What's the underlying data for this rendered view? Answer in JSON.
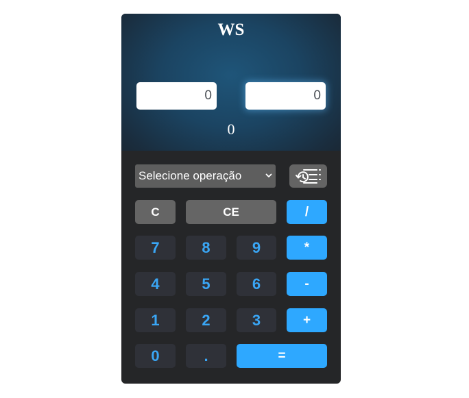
{
  "calculator": {
    "title": "WS",
    "input_one": {
      "value": "",
      "placeholder": "0"
    },
    "input_two": {
      "value": "",
      "placeholder": "0"
    },
    "result": "0",
    "operation_select": {
      "selected": "Selecione operação"
    },
    "history_button_icon": "history-list-icon",
    "keys": {
      "clear": "C",
      "clear_entry": "CE",
      "divide": "/",
      "multiply": "*",
      "subtract": "-",
      "add": "+",
      "equals": "=",
      "decimal": ".",
      "digits": [
        "0",
        "1",
        "2",
        "3",
        "4",
        "5",
        "6",
        "7",
        "8",
        "9"
      ]
    },
    "colors": {
      "accent": "#2ea8ff",
      "digit_text": "#3aa6f5",
      "body": "#252628",
      "screen": "#1f5579"
    }
  }
}
